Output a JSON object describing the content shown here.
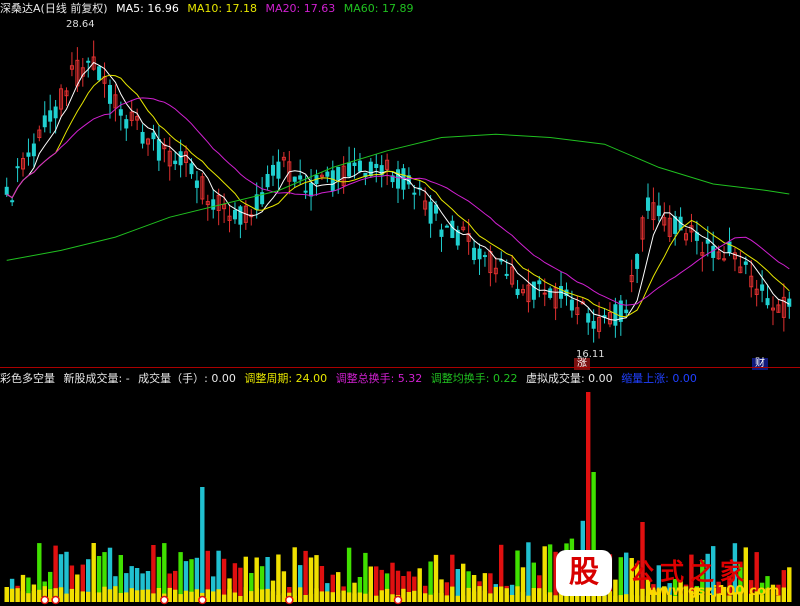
{
  "colors": {
    "background": "#000000",
    "ma5": "#ffffff",
    "ma10": "#e6e600",
    "ma20": "#d020d0",
    "ma60": "#20c020",
    "up_candle": "#e03030",
    "down_candle": "#20d0d0",
    "vol_red": "#e01010",
    "vol_cyan": "#20c0d0",
    "vol_green": "#40e000",
    "vol_yellow": "#f0e000"
  },
  "price_header": {
    "stock": "深桑达A(日线 前复权)",
    "ma5": "MA5: 16.96",
    "ma10": "MA10: 17.18",
    "ma20": "MA20: 17.63",
    "ma60": "MA60: 17.89"
  },
  "price_labels": {
    "high": "28.64",
    "low": "16.11",
    "badge_zhang": "涨",
    "badge_cai": "财"
  },
  "volume_header": {
    "title": "彩色多空量",
    "new_vol": "新股成交量: -",
    "vol_hand": "成交量（手）: 0.00",
    "adj_period": "调整周期: 24.00",
    "adj_turnover": "调整总换手: 5.32",
    "avg_turnover": "调整均换手: 0.22",
    "virtual_vol": "虚拟成交量: 0.00",
    "vol_up": "缩量上涨: 0.00"
  },
  "watermark": {
    "logo": "股",
    "title": "公式之家",
    "url": "www.gszj100.com"
  },
  "chart_data": {
    "type": "candlestick",
    "y_high_label": 28.64,
    "y_low_label": 16.11,
    "days": 145,
    "ma60_path": [
      [
        0,
        0.73
      ],
      [
        10,
        0.7
      ],
      [
        20,
        0.66
      ],
      [
        30,
        0.6
      ],
      [
        40,
        0.56
      ],
      [
        50,
        0.52
      ],
      [
        60,
        0.45
      ],
      [
        70,
        0.4
      ],
      [
        80,
        0.36
      ],
      [
        90,
        0.35
      ],
      [
        100,
        0.36
      ],
      [
        110,
        0.38
      ],
      [
        120,
        0.45
      ],
      [
        130,
        0.5
      ],
      [
        140,
        0.52
      ],
      [
        144,
        0.53
      ]
    ],
    "volume_series_note": "heights estimated per day"
  }
}
